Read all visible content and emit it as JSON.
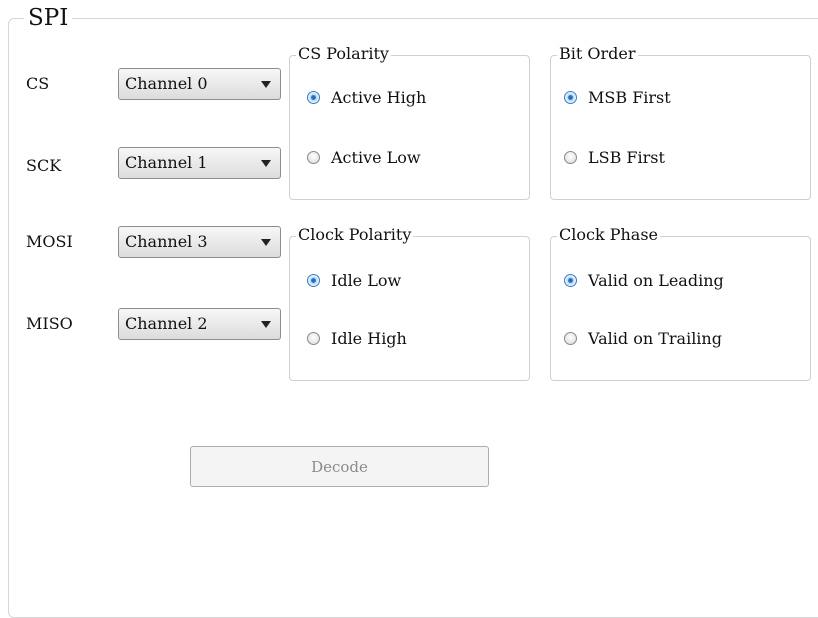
{
  "spi": {
    "title": "SPI",
    "pins": [
      {
        "label": "CS",
        "channel": "Channel 0"
      },
      {
        "label": "SCK",
        "channel": "Channel 1"
      },
      {
        "label": "MOSI",
        "channel": "Channel 3"
      },
      {
        "label": "MISO",
        "channel": "Channel 2"
      }
    ],
    "cs_polarity": {
      "title": "CS Polarity",
      "options": [
        "Active High",
        "Active Low"
      ],
      "selected": "Active High"
    },
    "bit_order": {
      "title": "Bit Order",
      "options": [
        "MSB First",
        "LSB First"
      ],
      "selected": "MSB First"
    },
    "clock_polarity": {
      "title": "Clock Polarity",
      "options": [
        "Idle Low",
        "Idle High"
      ],
      "selected": "Idle Low"
    },
    "clock_phase": {
      "title": "Clock Phase",
      "options": [
        "Valid on Leading",
        "Valid on Trailing"
      ],
      "selected": "Valid on Leading"
    },
    "decode_label": "Decode"
  },
  "colors": {
    "radio_selected": "#1a5fb4",
    "button_text_disabled": "#8a8a8a"
  }
}
